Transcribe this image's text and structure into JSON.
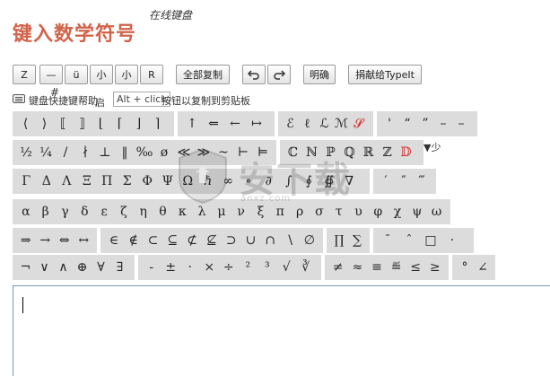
{
  "page": {
    "title": "键入数学符号",
    "subtitle": "在线键盘"
  },
  "toolbar": {
    "buttons": [
      "Z",
      "—",
      "ü",
      "小",
      "小",
      "R"
    ],
    "copy_all": "全部复制",
    "undo": "undo-icon",
    "redo": "redo-icon",
    "clear": "明确",
    "donate": "捐献给TypeIt"
  },
  "hint": {
    "text1": "键盘快捷键帮助",
    "tooltip": "Alt + click",
    "text2": "按钮以复制到剪贴板",
    "hash": "#",
    "qi": "启"
  },
  "keys": {
    "row1": {
      "g1": [
        "⟨",
        "⟩",
        "⟦",
        "⟧",
        "⌊",
        "⌈",
        "⌋",
        "⌉"
      ],
      "g2": [
        "↑",
        "⇐",
        "←",
        "↦"
      ],
      "g3": [
        "ℰ",
        "ℓ",
        "ℒ",
        "ℳ",
        "𝓢"
      ],
      "g4": [
        "'",
        "“",
        "”",
        "–",
        "–"
      ]
    },
    "row2": {
      "g1": [
        "½",
        "¼",
        "/",
        "∤",
        "⊥",
        "‖",
        "‰",
        "ø",
        "≪",
        "≫",
        "~",
        "⊢",
        "⊨"
      ],
      "g2": [
        "ℂ",
        "ℕ",
        "ℙ",
        "ℚ",
        "ℝ",
        "ℤ",
        "𝔻"
      ],
      "shao": "▼少"
    },
    "row3": {
      "g1": [
        "Γ",
        "Δ",
        "Λ",
        "Ξ",
        "Π",
        "Σ",
        "Φ",
        "Ψ",
        "Ω",
        "ℏ",
        "∞",
        "∘",
        "∂",
        "∫",
        "∮",
        "∯",
        "∇"
      ],
      "g2": [
        "′",
        "″",
        "‴"
      ]
    },
    "row4": {
      "g1": [
        "α",
        "β",
        "γ",
        "δ",
        "ε",
        "ζ",
        "η",
        "θ",
        "κ",
        "λ",
        "μ",
        "ν",
        "ξ",
        "π",
        "ρ",
        "σ",
        "τ",
        "υ",
        "φ",
        "χ",
        "ψ",
        "ω"
      ]
    },
    "row5": {
      "g1": [
        "⇒",
        "→",
        "⇔",
        "↔"
      ],
      "g2": [
        "∈",
        "∉",
        "⊂",
        "⊆",
        "⊄",
        "⊈",
        "⊃",
        "∪",
        "∩",
        "∖",
        "∅"
      ],
      "g3": [
        "∏",
        "∑"
      ],
      "g4": [
        "¯",
        "ˆ",
        "□",
        "·"
      ]
    },
    "row6": {
      "g1": [
        "¬",
        "∨",
        "∧",
        "⊕",
        "∀",
        "∃"
      ],
      "g2": [
        "-",
        "±",
        "·",
        "×",
        "÷",
        "²",
        "³",
        "√",
        "∛"
      ],
      "g3": [
        "≠",
        "≈",
        "≡",
        "≝",
        "≤",
        "≥"
      ],
      "g4": [
        "°",
        "∠"
      ]
    }
  },
  "editor": {
    "value": ""
  },
  "watermark": {
    "text": "安下载",
    "sub": "anxz.com"
  }
}
